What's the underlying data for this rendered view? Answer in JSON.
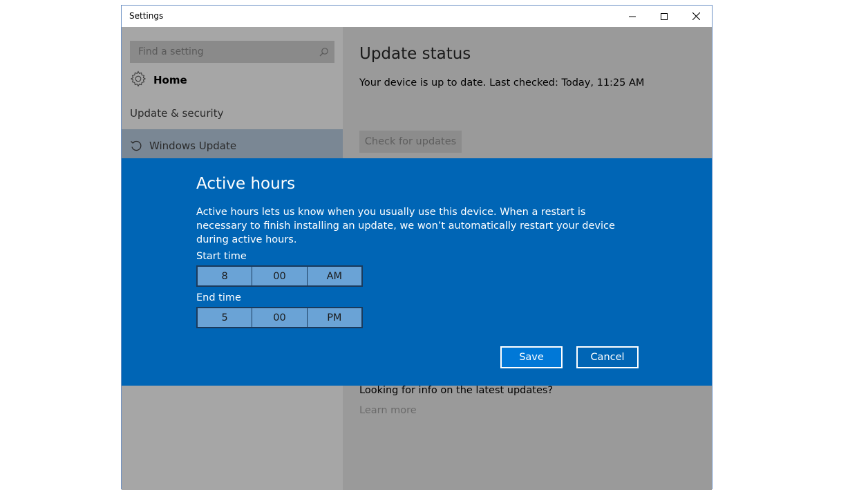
{
  "window": {
    "title": "Settings",
    "controls": {
      "minimize": "minimize-icon",
      "maximize": "maximize-icon",
      "close": "close-icon"
    }
  },
  "sidebar": {
    "search_placeholder": "Find a setting",
    "home_label": "Home",
    "section_title": "Update & security",
    "selected_item": "Windows Update"
  },
  "main": {
    "heading": "Update status",
    "status_text": "Your device is up to date. Last checked: Today, 11:25 AM",
    "check_button": "Check for updates",
    "info_question": "Looking for info on the latest updates?",
    "learn_more": "Learn more"
  },
  "dialog": {
    "title": "Active hours",
    "description": "Active hours lets us know when you usually use this device. When a restart is necessary to finish installing an update, we won’t automatically restart your device during active hours.",
    "start_label": "Start time",
    "start": {
      "hour": "8",
      "minute": "00",
      "period": "AM"
    },
    "end_label": "End time",
    "end": {
      "hour": "5",
      "minute": "00",
      "period": "PM"
    },
    "save_label": "Save",
    "cancel_label": "Cancel"
  },
  "colors": {
    "dialog_bg": "#0065b5",
    "save_bg": "#0078d7",
    "overlay_sidebar": "#a6a6a6",
    "overlay_main": "#9a9a9a"
  }
}
